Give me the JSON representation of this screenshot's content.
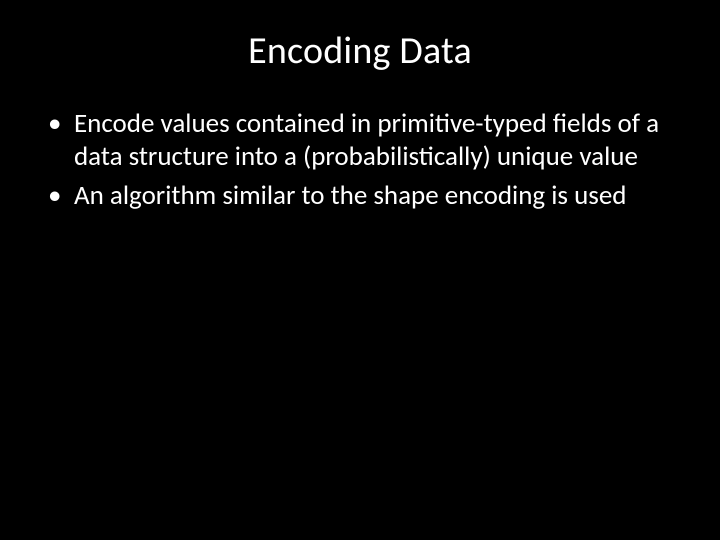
{
  "slide": {
    "title": "Encoding Data",
    "bullets": [
      "Encode values contained in primitive-typed fields of a data structure into a (probabilistically) unique value",
      "An algorithm similar to the shape encoding is used"
    ]
  }
}
